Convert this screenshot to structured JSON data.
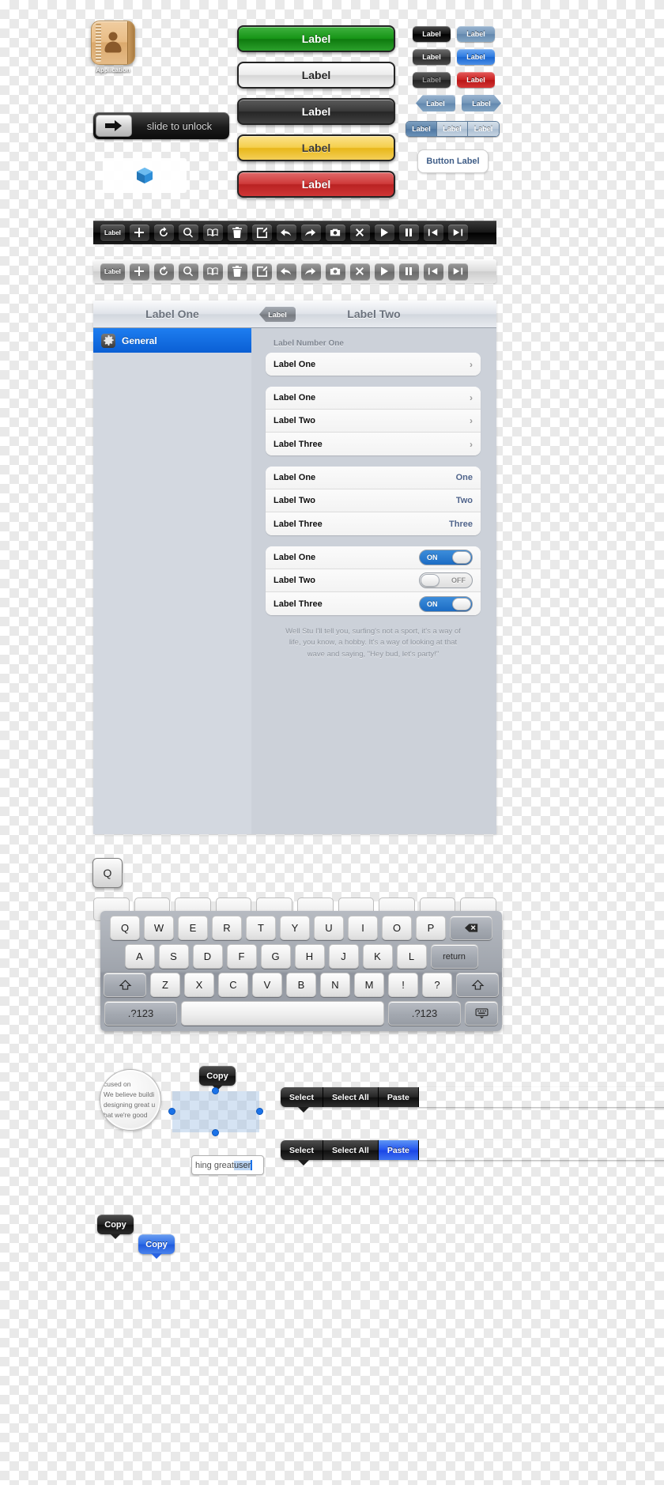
{
  "app_icon": {
    "label": "Application",
    "icon": "address-book-icon"
  },
  "slide_unlock": {
    "text": "slide to unlock",
    "arrow_icon": "arrow-right-icon"
  },
  "cube_badge": {
    "icon": "cube-icon"
  },
  "big_buttons": [
    {
      "label": "Label",
      "style": "green"
    },
    {
      "label": "Label",
      "style": "white"
    },
    {
      "label": "Label",
      "style": "dark"
    },
    {
      "label": "Label",
      "style": "gold"
    },
    {
      "label": "Label",
      "style": "red"
    }
  ],
  "small_buttons": {
    "rows": [
      [
        {
          "label": "Label",
          "style": "black"
        },
        {
          "label": "Label",
          "style": "blue"
        }
      ],
      [
        {
          "label": "Label",
          "style": "gray"
        },
        {
          "label": "Label",
          "style": "brightblue"
        }
      ],
      [
        {
          "label": "Label",
          "style": "gray-d"
        },
        {
          "label": "Label",
          "style": "red"
        }
      ]
    ],
    "back_label": "Label",
    "forward_label": "Label"
  },
  "segmented": {
    "items": [
      "Label",
      "Label",
      "Label"
    ],
    "selected_index": 0
  },
  "button_label_box": {
    "label": "Button Label"
  },
  "toolbar": {
    "label": "Label",
    "icons": [
      "plus-icon",
      "refresh-icon",
      "search-icon",
      "book-icon",
      "trash-icon",
      "compose-icon",
      "reply-icon",
      "share-icon",
      "camera-icon",
      "close-icon",
      "play-icon",
      "pause-icon",
      "rewind-icon",
      "fast-forward-icon"
    ]
  },
  "settings": {
    "left_title": "Label One",
    "right_title": "Label Two",
    "back_label": "Label",
    "sidebar_item": {
      "label": "General",
      "icon": "gear-icon"
    },
    "group_header": "Label Number One",
    "group_single": [
      {
        "label": "Label One",
        "accessory": "chevron"
      }
    ],
    "group_disclosure": [
      {
        "label": "Label One",
        "accessory": "chevron"
      },
      {
        "label": "Label Two",
        "accessory": "chevron"
      },
      {
        "label": "Label Three",
        "accessory": "chevron"
      }
    ],
    "group_values": [
      {
        "label": "Label One",
        "value": "One"
      },
      {
        "label": "Label Two",
        "value": "Two"
      },
      {
        "label": "Label Three",
        "value": "Three"
      }
    ],
    "group_switches": [
      {
        "label": "Label One",
        "state": "ON",
        "on": true
      },
      {
        "label": "Label Two",
        "state": "OFF",
        "on": false
      },
      {
        "label": "Label Three",
        "state": "ON",
        "on": true
      }
    ],
    "footer_text": "Well Stu I'll tell you, surfing's not a sport, it's a way of life, you know, a hobby. It's a way of looking at that wave and saying, \"Hey bud, let's party!\""
  },
  "popup_key": {
    "label": "Q"
  },
  "keyboard": {
    "row1": [
      "Q",
      "W",
      "E",
      "R",
      "T",
      "Y",
      "U",
      "I",
      "O",
      "P"
    ],
    "backspace": "delete-icon",
    "row2": [
      "A",
      "S",
      "D",
      "F",
      "G",
      "H",
      "J",
      "K",
      "L"
    ],
    "return_label": "return",
    "row3": [
      "Z",
      "X",
      "C",
      "V",
      "B",
      "N",
      "M",
      "!",
      "?"
    ],
    "shift_icon": "shift-icon",
    "num_left": ".?123",
    "num_right": ".?123",
    "space_label": "",
    "dismiss_icon": "keyboard-dismiss-icon"
  },
  "magnifier": {
    "lines": [
      "cused on",
      "We believe buildi",
      "designing great u",
      "hat we're good"
    ]
  },
  "copy_bubbles": {
    "top": "Copy",
    "dark": "Copy",
    "blue": "Copy"
  },
  "edit_menus": [
    {
      "items": [
        "Select",
        "Select All",
        "Paste"
      ],
      "active_index": -1
    },
    {
      "items": [
        "Select",
        "Select All",
        "Paste"
      ],
      "active_index": 2
    }
  ],
  "text_field": {
    "before": "hing great ",
    "selected": "user",
    "after": ""
  },
  "colors": {
    "accent_blue": "#1a72e8",
    "selection_blue": "#0a5fd4",
    "green": "#169416",
    "red": "#b92222",
    "gold": "#e8b71a"
  }
}
